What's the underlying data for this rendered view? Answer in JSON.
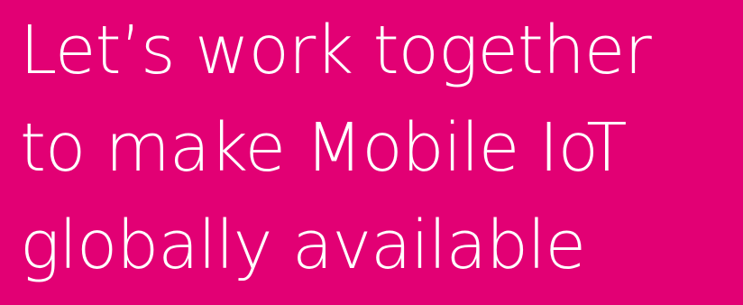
{
  "colors": {
    "background": "#e20074",
    "text": "#ffffff"
  },
  "hero": {
    "lines": [
      "Let’s work together",
      "to make Mobile IoT",
      "globally available"
    ]
  }
}
